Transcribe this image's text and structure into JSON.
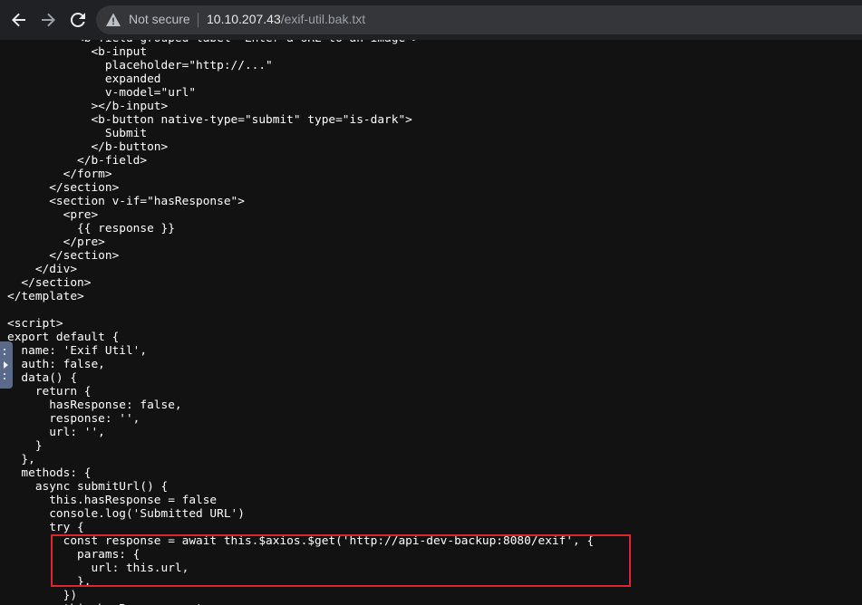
{
  "browser": {
    "back_icon": "arrow-left-icon",
    "forward_icon": "arrow-right-icon",
    "reload_icon": "reload-icon",
    "security_icon": "warning-triangle-icon",
    "security_label": "Not secure",
    "url_host": "10.10.207.43",
    "url_path": "/exif-util.bak.txt"
  },
  "document": {
    "lines": [
      "          <b-field grouped label=\"Enter a URL to an image\">",
      "            <b-input",
      "              placeholder=\"http://...\"",
      "              expanded",
      "              v-model=\"url\"",
      "            ></b-input>",
      "            <b-button native-type=\"submit\" type=\"is-dark\">",
      "              Submit",
      "            </b-button>",
      "          </b-field>",
      "        </form>",
      "      </section>",
      "      <section v-if=\"hasResponse\">",
      "        <pre>",
      "          {{ response }}",
      "        </pre>",
      "      </section>",
      "    </div>",
      "  </section>",
      "</template>",
      "",
      "<script>",
      "export default {",
      "  name: 'Exif Util',",
      "  auth: false,",
      "  data() {",
      "    return {",
      "      hasResponse: false,",
      "      response: '',",
      "      url: '',",
      "    }",
      "  },",
      "  methods: {",
      "    async submitUrl() {",
      "      this.hasResponse = false",
      "      console.log('Submitted URL')",
      "      try {",
      "        const response = await this.$axios.$get('http://api-dev-backup:8080/exif', {",
      "          params: {",
      "            url: this.url,",
      "          },",
      "        })",
      "        this.hasResponse = true"
    ]
  },
  "colors": {
    "toolbar_bg": "#202124",
    "page_bg": "#121212",
    "text": "#ffffff",
    "highlight_border": "#e0242a"
  }
}
